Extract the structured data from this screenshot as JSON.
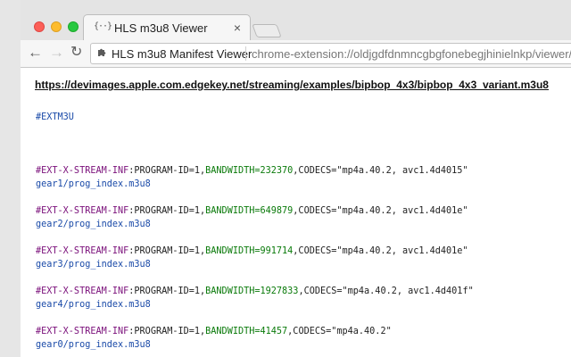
{
  "window": {
    "tab_title": "HLS m3u8 Viewer",
    "tab_icon": "{··}",
    "tab_close": "×"
  },
  "toolbar": {
    "back": "←",
    "forward": "→",
    "reload": "↻",
    "extension_name": "HLS m3u8 Manifest Viewer",
    "url": "chrome-extension://oldjgdfdnmncgbgfonebegjhinielnkp/viewer/ind"
  },
  "page": {
    "source_url": "https://devimages.apple.com.edgekey.net/streaming/examples/bipbop_4x3/bipbop_4x3_variant.m3u8",
    "header_tag": "#EXTM3U",
    "streams": [
      {
        "tag": "#EXT-X-STREAM-INF",
        "program": ":PROGRAM-ID=1,",
        "bandwidth": "BANDWIDTH=232370",
        "codecs": ",CODECS=\"mp4a.40.2, avc1.4d4015\"",
        "uri": "gear1/prog_index.m3u8"
      },
      {
        "tag": "#EXT-X-STREAM-INF",
        "program": ":PROGRAM-ID=1,",
        "bandwidth": "BANDWIDTH=649879",
        "codecs": ",CODECS=\"mp4a.40.2, avc1.4d401e\"",
        "uri": "gear2/prog_index.m3u8"
      },
      {
        "tag": "#EXT-X-STREAM-INF",
        "program": ":PROGRAM-ID=1,",
        "bandwidth": "BANDWIDTH=991714",
        "codecs": ",CODECS=\"mp4a.40.2, avc1.4d401e\"",
        "uri": "gear3/prog_index.m3u8"
      },
      {
        "tag": "#EXT-X-STREAM-INF",
        "program": ":PROGRAM-ID=1,",
        "bandwidth": "BANDWIDTH=1927833",
        "codecs": ",CODECS=\"mp4a.40.2, avc1.4d401f\"",
        "uri": "gear4/prog_index.m3u8"
      },
      {
        "tag": "#EXT-X-STREAM-INF",
        "program": ":PROGRAM-ID=1,",
        "bandwidth": "BANDWIDTH=41457",
        "codecs": ",CODECS=\"mp4a.40.2\"",
        "uri": "gear0/prog_index.m3u8"
      }
    ]
  },
  "colors": {
    "tag": "#7a0f7a",
    "bandwidth": "#0a7a0a",
    "uri": "#1a4aa8"
  }
}
